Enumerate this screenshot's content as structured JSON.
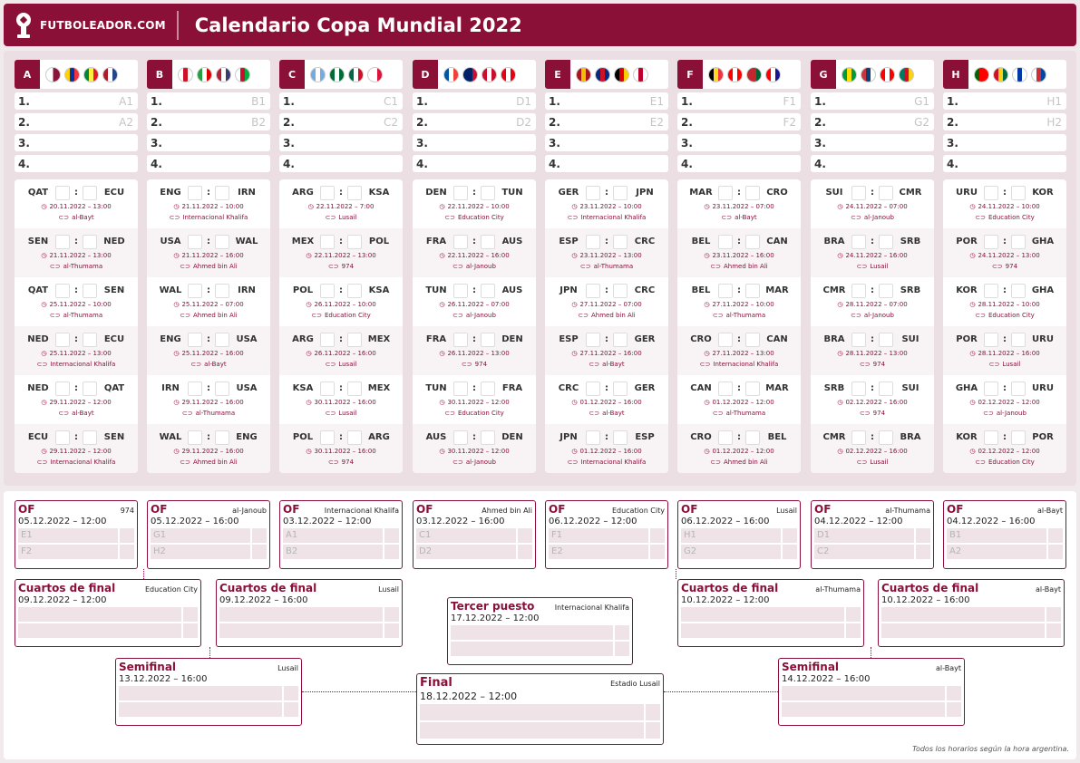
{
  "header": {
    "brand": "FUTBOLEADOR.COM",
    "title": "Calendario Copa Mundial 2022"
  },
  "colors": {
    "accent": "#8b1038",
    "background": "#f1eaed",
    "cell": "#efe3e8"
  },
  "groups": [
    {
      "letter": "A",
      "flags": [
        [
          "#fff",
          "#8a1538"
        ],
        [
          "#ffd100",
          "#0033a0",
          "#ef3340"
        ],
        [
          "#00853f",
          "#fdef42",
          "#e31b23"
        ],
        [
          "#ae1c28",
          "#fff",
          "#21468b"
        ]
      ],
      "positions": [
        {
          "n": "1.",
          "p": "A1"
        },
        {
          "n": "2.",
          "p": "A2"
        },
        {
          "n": "3.",
          "p": ""
        },
        {
          "n": "4.",
          "p": ""
        }
      ],
      "matches": [
        {
          "home": "QAT",
          "away": "ECU",
          "date": "20.11.2022 – 13:00",
          "stadium": "al-Bayt"
        },
        {
          "home": "SEN",
          "away": "NED",
          "date": "21.11.2022 – 13:00",
          "stadium": "al-Thumama"
        },
        {
          "home": "QAT",
          "away": "SEN",
          "date": "25.11.2022 – 10:00",
          "stadium": "al-Thumama"
        },
        {
          "home": "NED",
          "away": "ECU",
          "date": "25.11.2022 – 13:00",
          "stadium": "Internacional Khalifa"
        },
        {
          "home": "NED",
          "away": "QAT",
          "date": "29.11.2022 – 12:00",
          "stadium": "al-Bayt"
        },
        {
          "home": "ECU",
          "away": "SEN",
          "date": "29.11.2022 – 12:00",
          "stadium": "Internacional Khalifa"
        }
      ]
    },
    {
      "letter": "B",
      "flags": [
        [
          "#fff",
          "#ce1124",
          "#fff"
        ],
        [
          "#239f40",
          "#fff",
          "#da0000"
        ],
        [
          "#b22234",
          "#fff",
          "#3c3b6e"
        ],
        [
          "#fff",
          "#c8102e",
          "#00b140"
        ]
      ],
      "positions": [
        {
          "n": "1.",
          "p": "B1"
        },
        {
          "n": "2.",
          "p": "B2"
        },
        {
          "n": "3.",
          "p": ""
        },
        {
          "n": "4.",
          "p": ""
        }
      ],
      "matches": [
        {
          "home": "ENG",
          "away": "IRN",
          "date": "21.11.2022 – 10:00",
          "stadium": "Internacional Khalifa"
        },
        {
          "home": "USA",
          "away": "WAL",
          "date": "21.11.2022 – 16:00",
          "stadium": "Ahmed bin Ali"
        },
        {
          "home": "WAL",
          "away": "IRN",
          "date": "25.11.2022 – 07:00",
          "stadium": "Ahmed bin Ali"
        },
        {
          "home": "ENG",
          "away": "USA",
          "date": "25.11.2022 – 16:00",
          "stadium": "al-Bayt"
        },
        {
          "home": "IRN",
          "away": "USA",
          "date": "29.11.2022 – 16:00",
          "stadium": "al-Thumama"
        },
        {
          "home": "WAL",
          "away": "ENG",
          "date": "29.11.2022 – 16:00",
          "stadium": "Ahmed bin Ali"
        }
      ]
    },
    {
      "letter": "C",
      "flags": [
        [
          "#74acdf",
          "#fff",
          "#74acdf"
        ],
        [
          "#006c35",
          "#fff",
          "#006c35"
        ],
        [
          "#006847",
          "#fff",
          "#ce1126"
        ],
        [
          "#fff",
          "#fff",
          "#dc143c"
        ]
      ],
      "positions": [
        {
          "n": "1.",
          "p": "C1"
        },
        {
          "n": "2.",
          "p": "C2"
        },
        {
          "n": "3.",
          "p": ""
        },
        {
          "n": "4.",
          "p": ""
        }
      ],
      "matches": [
        {
          "home": "ARG",
          "away": "KSA",
          "date": "22.11.2022 – 7:00",
          "stadium": "Lusail"
        },
        {
          "home": "MEX",
          "away": "POL",
          "date": "22.11.2022 – 13:00",
          "stadium": "974"
        },
        {
          "home": "POL",
          "away": "KSA",
          "date": "26.11.2022 – 10:00",
          "stadium": "Education City"
        },
        {
          "home": "ARG",
          "away": "MEX",
          "date": "26.11.2022 – 16:00",
          "stadium": "Lusail"
        },
        {
          "home": "KSA",
          "away": "MEX",
          "date": "30.11.2022 – 16:00",
          "stadium": "Lusail"
        },
        {
          "home": "POL",
          "away": "ARG",
          "date": "30.11.2022 – 16:00",
          "stadium": "974"
        }
      ]
    },
    {
      "letter": "D",
      "flags": [
        [
          "#0055a4",
          "#fff",
          "#ef4135"
        ],
        [
          "#012169",
          "#012169",
          "#c8102e"
        ],
        [
          "#c8102e",
          "#fff",
          "#c8102e"
        ],
        [
          "#e70013",
          "#fff",
          "#e70013"
        ]
      ],
      "positions": [
        {
          "n": "1.",
          "p": "D1"
        },
        {
          "n": "2.",
          "p": "D2"
        },
        {
          "n": "3.",
          "p": ""
        },
        {
          "n": "4.",
          "p": ""
        }
      ],
      "matches": [
        {
          "home": "DEN",
          "away": "TUN",
          "date": "22.11.2022 – 10:00",
          "stadium": "Education City"
        },
        {
          "home": "FRA",
          "away": "AUS",
          "date": "22.11.2022 – 16:00",
          "stadium": "al-Janoub"
        },
        {
          "home": "TUN",
          "away": "AUS",
          "date": "26.11.2022 – 07:00",
          "stadium": "al-Janoub"
        },
        {
          "home": "FRA",
          "away": "DEN",
          "date": "26.11.2022 – 13:00",
          "stadium": "974"
        },
        {
          "home": "TUN",
          "away": "FRA",
          "date": "30.11.2022 – 12:00",
          "stadium": "Education City"
        },
        {
          "home": "AUS",
          "away": "DEN",
          "date": "30.11.2022 – 12:00",
          "stadium": "al-Janoub"
        }
      ]
    },
    {
      "letter": "E",
      "flags": [
        [
          "#aa151b",
          "#f1bf00",
          "#aa151b"
        ],
        [
          "#002b7f",
          "#ce1126",
          "#002b7f"
        ],
        [
          "#000",
          "#dd0000",
          "#ffce00"
        ],
        [
          "#fff",
          "#bc002d",
          "#fff"
        ]
      ],
      "positions": [
        {
          "n": "1.",
          "p": "E1"
        },
        {
          "n": "2.",
          "p": "E2"
        },
        {
          "n": "3.",
          "p": ""
        },
        {
          "n": "4.",
          "p": ""
        }
      ],
      "matches": [
        {
          "home": "GER",
          "away": "JPN",
          "date": "23.11.2022 – 10:00",
          "stadium": "Internacional Khalifa"
        },
        {
          "home": "ESP",
          "away": "CRC",
          "date": "23.11.2022 – 13:00",
          "stadium": "al-Thumama"
        },
        {
          "home": "JPN",
          "away": "CRC",
          "date": "27.11.2022 – 07:00",
          "stadium": "Ahmed bin Ali"
        },
        {
          "home": "ESP",
          "away": "GER",
          "date": "27.11.2022 – 16:00",
          "stadium": "al-Bayt"
        },
        {
          "home": "CRC",
          "away": "GER",
          "date": "01.12.2022 – 16:00",
          "stadium": "al-Bayt"
        },
        {
          "home": "JPN",
          "away": "ESP",
          "date": "01.12.2022 – 16:00",
          "stadium": "Internacional Khalifa"
        }
      ]
    },
    {
      "letter": "F",
      "flags": [
        [
          "#000",
          "#fdda24",
          "#ef3340"
        ],
        [
          "#ff0000",
          "#fff",
          "#ff0000"
        ],
        [
          "#c1272d",
          "#c1272d",
          "#006233"
        ],
        [
          "#ff0000",
          "#fff",
          "#171796"
        ]
      ],
      "positions": [
        {
          "n": "1.",
          "p": "F1"
        },
        {
          "n": "2.",
          "p": "F2"
        },
        {
          "n": "3.",
          "p": ""
        },
        {
          "n": "4.",
          "p": ""
        }
      ],
      "matches": [
        {
          "home": "MAR",
          "away": "CRO",
          "date": "23.11.2022 – 07:00",
          "stadium": "al-Bayt"
        },
        {
          "home": "BEL",
          "away": "CAN",
          "date": "23.11.2022 – 16:00",
          "stadium": "Ahmed bin Ali"
        },
        {
          "home": "BEL",
          "away": "MAR",
          "date": "27.11.2022 – 10:00",
          "stadium": "al-Thumama"
        },
        {
          "home": "CRO",
          "away": "CAN",
          "date": "27.11.2022 – 13:00",
          "stadium": "Internacional Khalifa"
        },
        {
          "home": "CAN",
          "away": "MAR",
          "date": "01.12.2022 – 12:00",
          "stadium": "al-Thumama"
        },
        {
          "home": "CRO",
          "away": "BEL",
          "date": "01.12.2022 – 12:00",
          "stadium": "Ahmed bin Ali"
        }
      ]
    },
    {
      "letter": "G",
      "flags": [
        [
          "#009c3b",
          "#ffdf00",
          "#009c3b"
        ],
        [
          "#c6363c",
          "#0c4076",
          "#fff"
        ],
        [
          "#ff0000",
          "#fff",
          "#ff0000"
        ],
        [
          "#007a5e",
          "#ce1126",
          "#fcd116"
        ]
      ],
      "positions": [
        {
          "n": "1.",
          "p": "G1"
        },
        {
          "n": "2.",
          "p": "G2"
        },
        {
          "n": "3.",
          "p": ""
        },
        {
          "n": "4.",
          "p": ""
        }
      ],
      "matches": [
        {
          "home": "SUI",
          "away": "CMR",
          "date": "24.11.2022 – 07:00",
          "stadium": "al-Janoub"
        },
        {
          "home": "BRA",
          "away": "SRB",
          "date": "24.11.2022 – 16:00",
          "stadium": "Lusail"
        },
        {
          "home": "CMR",
          "away": "SRB",
          "date": "28.11.2022 – 07:00",
          "stadium": "al-Janoub"
        },
        {
          "home": "BRA",
          "away": "SUI",
          "date": "28.11.2022 – 13:00",
          "stadium": "974"
        },
        {
          "home": "SRB",
          "away": "SUI",
          "date": "02.12.2022 – 16:00",
          "stadium": "974"
        },
        {
          "home": "CMR",
          "away": "BRA",
          "date": "02.12.2022 – 16:00",
          "stadium": "Lusail"
        }
      ]
    },
    {
      "letter": "H",
      "flags": [
        [
          "#006600",
          "#ff0000",
          "#ff0000"
        ],
        [
          "#ce1126",
          "#fcd116",
          "#006b3f"
        ],
        [
          "#fff",
          "#0038a8",
          "#fff"
        ],
        [
          "#fff",
          "#cd2e3a",
          "#0047a0"
        ]
      ],
      "positions": [
        {
          "n": "1.",
          "p": "H1"
        },
        {
          "n": "2.",
          "p": "H2"
        },
        {
          "n": "3.",
          "p": ""
        },
        {
          "n": "4.",
          "p": ""
        }
      ],
      "matches": [
        {
          "home": "URU",
          "away": "KOR",
          "date": "24.11.2022 – 10:00",
          "stadium": "Education City"
        },
        {
          "home": "POR",
          "away": "GHA",
          "date": "24.11.2022 – 13:00",
          "stadium": "974"
        },
        {
          "home": "KOR",
          "away": "GHA",
          "date": "28.11.2022 – 10:00",
          "stadium": "Education City"
        },
        {
          "home": "POR",
          "away": "URU",
          "date": "28.11.2022 – 16:00",
          "stadium": "Lusail"
        },
        {
          "home": "GHA",
          "away": "URU",
          "date": "02.12.2022 – 12:00",
          "stadium": "al-Janoub"
        },
        {
          "home": "KOR",
          "away": "POR",
          "date": "02.12.2022 – 12:00",
          "stadium": "Education City"
        }
      ]
    }
  ],
  "knockout": [
    {
      "round": "OF",
      "venue": "974",
      "date": "05.12.2022 – 12:00",
      "t1": "E1",
      "t2": "F2"
    },
    {
      "round": "OF",
      "venue": "al-Janoub",
      "date": "05.12.2022 – 16:00",
      "t1": "G1",
      "t2": "H2"
    },
    {
      "round": "OF",
      "venue": "Internacional Khalifa",
      "date": "03.12.2022 – 12:00",
      "t1": "A1",
      "t2": "B2"
    },
    {
      "round": "OF",
      "venue": "Ahmed bin Ali",
      "date": "03.12.2022 – 16:00",
      "t1": "C1",
      "t2": "D2"
    },
    {
      "round": "OF",
      "venue": "Education City",
      "date": "06.12.2022 – 12:00",
      "t1": "F1",
      "t2": "E2"
    },
    {
      "round": "OF",
      "venue": "Lusail",
      "date": "06.12.2022 – 16:00",
      "t1": "H1",
      "t2": "G2"
    },
    {
      "round": "OF",
      "venue": "al-Thumama",
      "date": "04.12.2022 – 12:00",
      "t1": "D1",
      "t2": "C2"
    },
    {
      "round": "OF",
      "venue": "al-Bayt",
      "date": "04.12.2022 – 16:00",
      "t1": "B1",
      "t2": "A2"
    },
    {
      "round": "Cuartos de final",
      "venue": "Education City",
      "date": "09.12.2022 – 12:00",
      "t1": "",
      "t2": ""
    },
    {
      "round": "Cuartos de final",
      "venue": "Lusail",
      "date": "09.12.2022 – 16:00",
      "t1": "",
      "t2": ""
    },
    {
      "round": "Cuartos de final",
      "venue": "al-Thumama",
      "date": "10.12.2022 – 12:00",
      "t1": "",
      "t2": ""
    },
    {
      "round": "Cuartos de final",
      "venue": "al-Bayt",
      "date": "10.12.2022 – 16:00",
      "t1": "",
      "t2": ""
    },
    {
      "round": "Tercer puesto",
      "venue": "Internacional Khalifa",
      "date": "17.12.2022 – 12:00",
      "t1": "",
      "t2": ""
    },
    {
      "round": "Semifinal",
      "venue": "Lusail",
      "date": "13.12.2022 – 16:00",
      "t1": "",
      "t2": ""
    },
    {
      "round": "Semifinal",
      "venue": "al-Bayt",
      "date": "14.12.2022 – 16:00",
      "t1": "",
      "t2": ""
    },
    {
      "round": "Final",
      "venue": "Estadio Lusail",
      "date": "18.12.2022 – 12:00",
      "t1": "",
      "t2": ""
    }
  ],
  "footer": "Todos los horarios según la hora argentina."
}
